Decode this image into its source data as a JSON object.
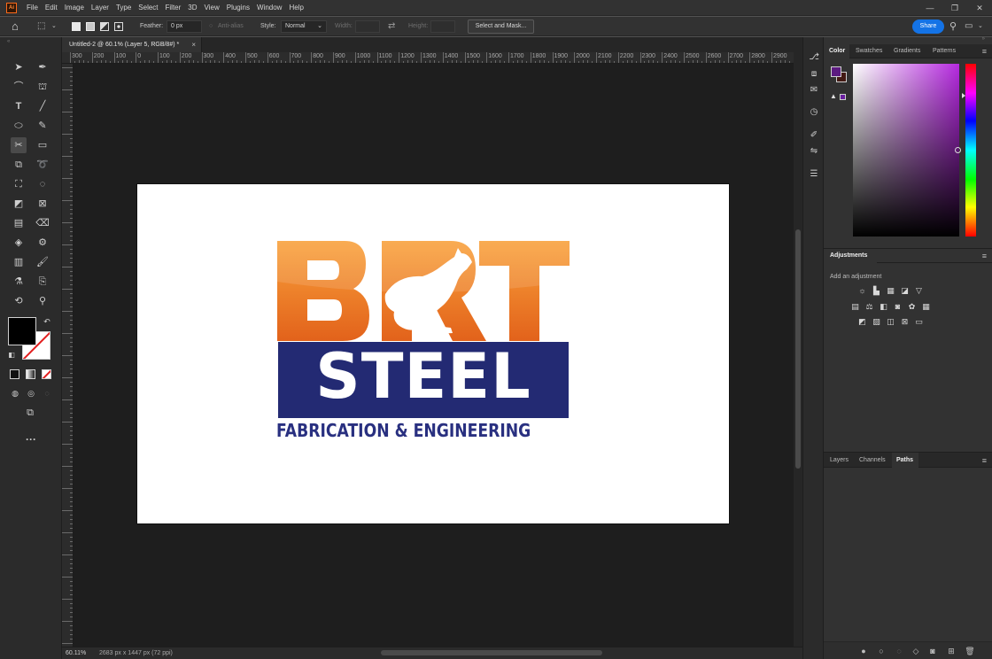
{
  "app": {
    "logo_text": "Ai",
    "menus": [
      "File",
      "Edit",
      "Image",
      "Layer",
      "Type",
      "Select",
      "Filter",
      "3D",
      "View",
      "Plugins",
      "Window",
      "Help"
    ],
    "window_controls": [
      "—",
      "❐",
      "✕"
    ]
  },
  "options_bar": {
    "feather_label": "Feather:",
    "feather_value": "0 px",
    "anti_alias_label": "Anti-alias",
    "style_label": "Style:",
    "style_value": "Normal",
    "width_label": "Width:",
    "height_label": "Height:",
    "select_mask_label": "Select and Mask...",
    "share_label": "Share"
  },
  "document": {
    "tab_title": "Untitled-2 @ 60.1% (Layer 5, RGB/8#) *",
    "tab_close": "×",
    "zoom": "60.11%",
    "size_info": "2683 px x 1447 px (72 ppi)"
  },
  "ruler": {
    "labels": [
      "300",
      "200",
      "100",
      "0",
      "100",
      "200",
      "300",
      "400",
      "500",
      "600",
      "700",
      "800",
      "900",
      "1000",
      "1100",
      "1200",
      "1300",
      "1400",
      "1500",
      "1600",
      "1700",
      "1800",
      "1900",
      "2000",
      "2100",
      "2200",
      "2300",
      "2400",
      "2500",
      "2600",
      "2700",
      "2800",
      "2900"
    ]
  },
  "logo": {
    "brt_text": "BRT",
    "steel_text": "STEEL",
    "tagline": "FABRICATION & ENGINEERING",
    "orange_top": "#f9a13a",
    "orange_bottom": "#e2621b",
    "navy": "#232a73"
  },
  "panels": {
    "color_tabs": [
      "Color",
      "Swatches",
      "Gradients",
      "Patterns"
    ],
    "active_color_tab": "Color",
    "foreground_color": "#5c1b80",
    "background_color": "#431a14",
    "adjustments_title": "Adjustments",
    "adjustments_hint": "Add an adjustment",
    "layers_tabs": [
      "Layers",
      "Channels",
      "Paths"
    ],
    "active_layers_tab": "Paths",
    "menu_glyph": "≡"
  },
  "accent_color": "#1473e6"
}
